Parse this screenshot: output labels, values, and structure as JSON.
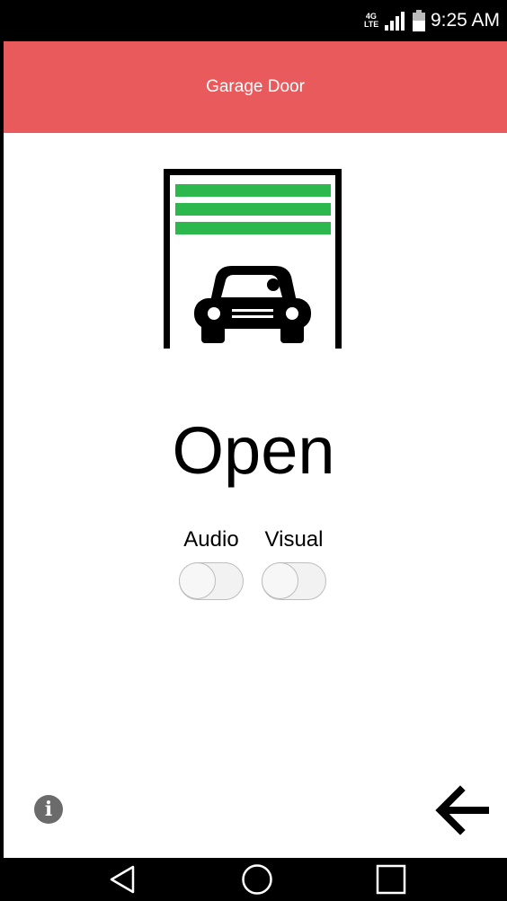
{
  "status_bar": {
    "network_top": "4G",
    "network_bottom": "LTE",
    "time": "9:25 AM"
  },
  "header": {
    "title": "Garage Door",
    "background_color": "#e85a5c"
  },
  "garage": {
    "illustration_icon": "garage-car-icon",
    "door_color": "#2db84d",
    "state_label": "Open"
  },
  "toggles": [
    {
      "label": "Audio",
      "checked": false
    },
    {
      "label": "Visual",
      "checked": false
    }
  ],
  "footer": {
    "info_icon": "info-icon",
    "back_icon": "arrow-left-icon"
  },
  "nav": {
    "back_icon": "triangle-back-icon",
    "home_icon": "circle-home-icon",
    "recents_icon": "square-recents-icon"
  }
}
